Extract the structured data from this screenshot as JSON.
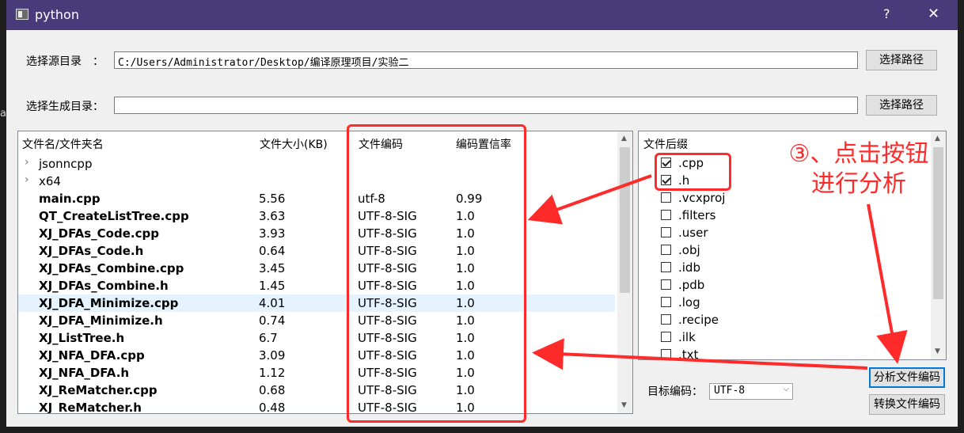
{
  "left_edge_fragment": "a",
  "titlebar": {
    "title": "python",
    "help_label": "?",
    "close_label": "✕"
  },
  "source_dir": {
    "label": "选择源目录　：",
    "value": "C:/Users/Administrator/Desktop/编译原理项目/实验二",
    "button": "选择路径"
  },
  "output_dir": {
    "label": "选择生成目录：",
    "value": "",
    "button": "选择路径"
  },
  "file_table": {
    "headers": [
      "文件名/文件夹名",
      "文件大小(KB)",
      "文件编码",
      "编码置信率"
    ],
    "rows": [
      {
        "name": "jsonncpp",
        "size": "",
        "encoding": "",
        "confidence": "",
        "folder": true,
        "expander": "›"
      },
      {
        "name": "x64",
        "size": "",
        "encoding": "",
        "confidence": "",
        "folder": true,
        "expander": "›"
      },
      {
        "name": "main.cpp",
        "size": "5.56",
        "encoding": "utf-8",
        "confidence": "0.99"
      },
      {
        "name": "QT_CreateListTree.cpp",
        "size": "3.63",
        "encoding": "UTF-8-SIG",
        "confidence": "1.0"
      },
      {
        "name": "XJ_DFAs_Code.cpp",
        "size": "3.93",
        "encoding": "UTF-8-SIG",
        "confidence": "1.0"
      },
      {
        "name": "XJ_DFAs_Code.h",
        "size": "0.64",
        "encoding": "UTF-8-SIG",
        "confidence": "1.0"
      },
      {
        "name": "XJ_DFAs_Combine.cpp",
        "size": "3.45",
        "encoding": "UTF-8-SIG",
        "confidence": "1.0"
      },
      {
        "name": "XJ_DFAs_Combine.h",
        "size": "1.45",
        "encoding": "UTF-8-SIG",
        "confidence": "1.0"
      },
      {
        "name": "XJ_DFA_Minimize.cpp",
        "size": "4.01",
        "encoding": "UTF-8-SIG",
        "confidence": "1.0",
        "selected": true
      },
      {
        "name": "XJ_DFA_Minimize.h",
        "size": "0.74",
        "encoding": "UTF-8-SIG",
        "confidence": "1.0"
      },
      {
        "name": "XJ_ListTree.h",
        "size": "6.7",
        "encoding": "UTF-8-SIG",
        "confidence": "1.0"
      },
      {
        "name": "XJ_NFA_DFA.cpp",
        "size": "3.09",
        "encoding": "UTF-8-SIG",
        "confidence": "1.0"
      },
      {
        "name": "XJ_NFA_DFA.h",
        "size": "1.12",
        "encoding": "UTF-8-SIG",
        "confidence": "1.0"
      },
      {
        "name": "XJ_ReMatcher.cpp",
        "size": "0.68",
        "encoding": "UTF-8-SIG",
        "confidence": "1.0"
      },
      {
        "name": "XJ_ReMatcher.h",
        "size": "0.48",
        "encoding": "UTF-8-SIG",
        "confidence": "1.0"
      }
    ]
  },
  "ext_list": {
    "header": "文件后缀",
    "items": [
      {
        "label": ".cpp",
        "checked": true
      },
      {
        "label": ".h",
        "checked": true
      },
      {
        "label": ".vcxproj",
        "checked": false
      },
      {
        "label": ".filters",
        "checked": false
      },
      {
        "label": ".user",
        "checked": false
      },
      {
        "label": ".obj",
        "checked": false
      },
      {
        "label": ".idb",
        "checked": false
      },
      {
        "label": ".pdb",
        "checked": false
      },
      {
        "label": ".log",
        "checked": false
      },
      {
        "label": ".recipe",
        "checked": false
      },
      {
        "label": ".ilk",
        "checked": false
      },
      {
        "label": ".txt",
        "checked": false
      }
    ]
  },
  "target_encoding": {
    "label": "目标编码：",
    "value": "UTF-8"
  },
  "buttons": {
    "analyze": "分析文件编码",
    "convert": "转换文件编码"
  },
  "annotation": {
    "line1": "③、点击按钮",
    "line2": "进行分析",
    "color": "#ff2a2a"
  }
}
